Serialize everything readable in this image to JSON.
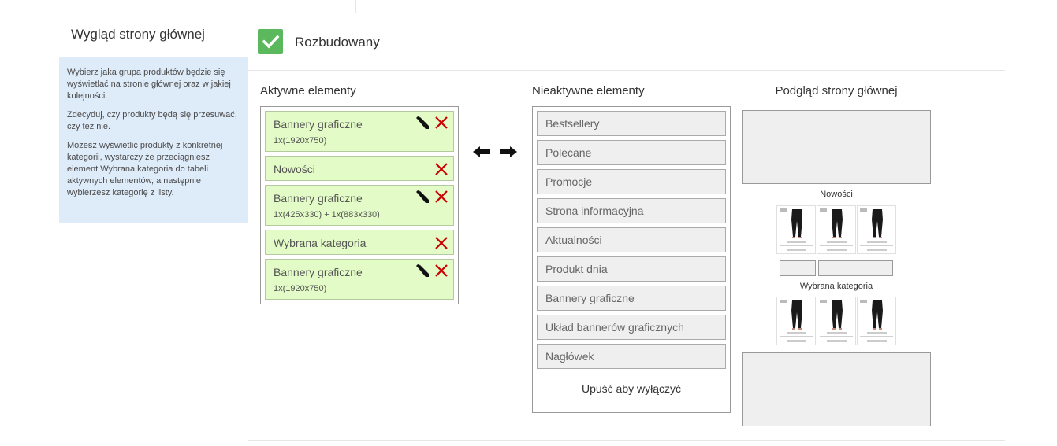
{
  "sidebar": {
    "title": "Wygląd strony głównej",
    "info": [
      "Wybierz jaka grupa produktów będzie się wyświetlać na stronie głównej oraz w jakiej kolejności.",
      "Zdecyduj, czy produkty będą się przesuwać, czy też nie.",
      "Możesz wyświetlić produkty z konkretnej kategorii, wystarczy że przeciągniesz element Wybrana kategoria do tabeli aktywnych elementów, a następnie wybierzesz kategorię z listy."
    ]
  },
  "option": {
    "label": "Rozbudowany",
    "checked": true
  },
  "active": {
    "title": "Aktywne elementy",
    "items": [
      {
        "label": "Bannery graficzne",
        "sub": "1x(1920x750)",
        "editable": true
      },
      {
        "label": "Nowości",
        "sub": "",
        "editable": false
      },
      {
        "label": "Bannery graficzne",
        "sub": "1x(425x330) + 1x(883x330)",
        "editable": true
      },
      {
        "label": "Wybrana kategoria",
        "sub": "",
        "editable": false
      },
      {
        "label": "Bannery graficzne",
        "sub": "1x(1920x750)",
        "editable": true
      }
    ]
  },
  "inactive": {
    "title": "Nieaktywne elementy",
    "items": [
      "Bestsellery",
      "Polecane",
      "Promocje",
      "Strona informacyjna",
      "Aktualności",
      "Produkt dnia",
      "Bannery graficzne",
      "Układ bannerów graficznych",
      "Nagłówek"
    ],
    "drop_text": "Upuść aby wyłączyć"
  },
  "preview": {
    "title": "Podgląd strony głównej",
    "section1": "Nowości",
    "section2": "Wybrana kategoria"
  },
  "colors": {
    "active_bg": "#e3fcc7",
    "inactive_bg": "#efefef",
    "check_green": "#5cb85c",
    "delete_red": "#cc0000",
    "info_bg": "#deebf9"
  },
  "icons": [
    "check-icon",
    "pencil-icon",
    "delete-icon",
    "arrow-left-icon",
    "arrow-right-icon"
  ]
}
